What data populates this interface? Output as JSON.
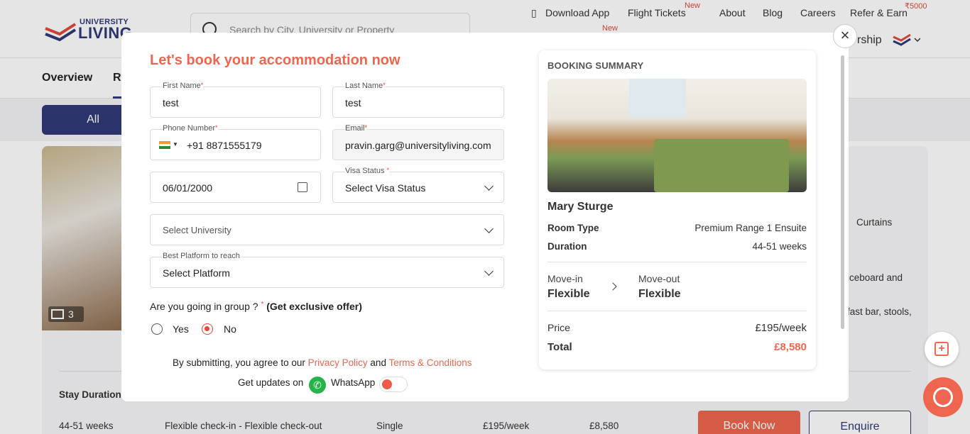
{
  "header": {
    "logo_line1": "UNIVERSITY",
    "logo_line2": "LIVING",
    "search_placeholder": "Search by City, University or Property",
    "links": {
      "download_app": "Download App",
      "flight_tickets": "Flight Tickets",
      "flight_new": "New",
      "about": "About",
      "blog": "Blog",
      "careers": "Careers",
      "refer": "Refer & Earn",
      "refer_amount": "₹5000",
      "second_new": "New",
      "partnership_partial": "rship"
    }
  },
  "tabs": {
    "overview": "Overview",
    "reviews_partial": "Re"
  },
  "filter": {
    "all": "All"
  },
  "background": {
    "image_count": "3",
    "amenity": "Curtains",
    "desc1": "iceboard and",
    "desc2": "fast bar, stools,",
    "stay_duration_label": "Stay Duration",
    "row": {
      "weeks": "44-51 weeks",
      "checkin": "Flexible check-in - Flexible check-out",
      "type": "Single",
      "price": "£195/week",
      "total": "£8,580"
    },
    "book_now": "Book Now",
    "enquire": "Enquire"
  },
  "modal": {
    "title": "Let's book your accommodation now",
    "first_name": {
      "label": "First Name",
      "value": "test"
    },
    "last_name": {
      "label": "Last Name",
      "value": "test"
    },
    "phone": {
      "label": "Phone Number",
      "value": "+91 8871555179"
    },
    "email": {
      "label": "Email",
      "value": "pravin.garg@universityliving.com"
    },
    "dob": {
      "value": "06/01/2000"
    },
    "visa": {
      "label": "Visa Status",
      "value": "Select Visa Status"
    },
    "university": {
      "placeholder": "Select University"
    },
    "platform": {
      "label": "Best Platform to reach",
      "value": "Select Platform"
    },
    "group_question": "Are you going in group ?",
    "group_offer": "(Get exclusive offer)",
    "yes": "Yes",
    "no": "No",
    "group_selected": "No",
    "terms_prefix": "By submitting, you agree to our",
    "privacy": "Privacy Policy",
    "and": "and",
    "terms": "Terms & Conditions",
    "updates_on": "Get updates on",
    "whatsapp": "WhatsApp",
    "whatsapp_enabled": false
  },
  "summary": {
    "title": "BOOKING SUMMARY",
    "property": "Mary Sturge",
    "room_type_label": "Room Type",
    "room_type": "Premium Range 1 Ensuite",
    "duration_label": "Duration",
    "duration": "44-51 weeks",
    "move_in_label": "Move-in",
    "move_in": "Flexible",
    "move_out_label": "Move-out",
    "move_out": "Flexible",
    "price_label": "Price",
    "price": "£195/week",
    "total_label": "Total",
    "total": "£8,580"
  },
  "colors": {
    "accent": "#ef6650",
    "brand": "#2f3a76",
    "whatsapp": "#25b34a"
  }
}
